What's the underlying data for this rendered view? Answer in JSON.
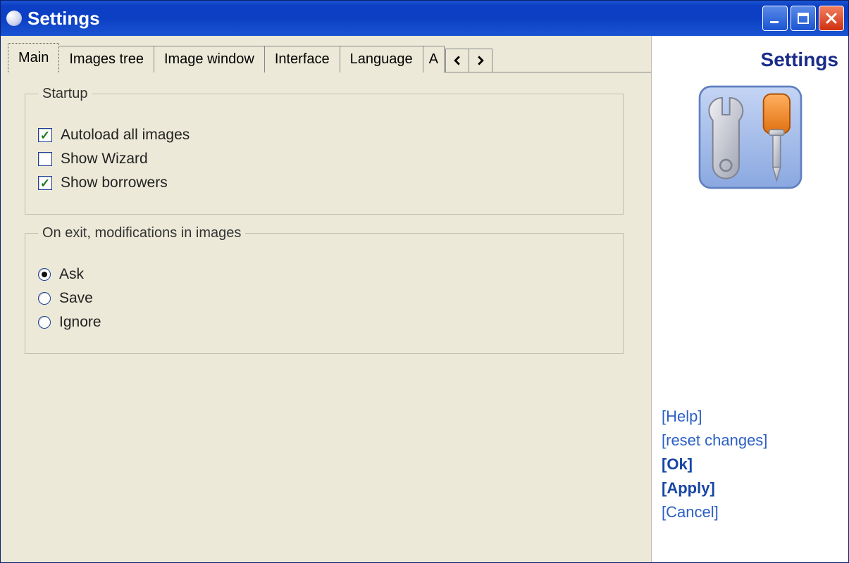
{
  "window": {
    "title": "Settings"
  },
  "tabs": {
    "items": [
      {
        "label": "Main"
      },
      {
        "label": "Images tree"
      },
      {
        "label": "Image window"
      },
      {
        "label": "Interface"
      },
      {
        "label": "Language"
      },
      {
        "label": "A"
      }
    ],
    "active_index": 0
  },
  "main": {
    "startup": {
      "legend": "Startup",
      "autoload": {
        "label": "Autoload all images",
        "checked": true
      },
      "wizard": {
        "label": "Show Wizard",
        "checked": false
      },
      "borrowers": {
        "label": "Show borrowers",
        "checked": true
      }
    },
    "exit": {
      "legend": "On exit, modifications in images",
      "selected": "ask",
      "ask": {
        "label": "Ask"
      },
      "save": {
        "label": "Save"
      },
      "ignore": {
        "label": "Ignore"
      }
    }
  },
  "side": {
    "title": "Settings",
    "links": {
      "help": "[Help]",
      "reset": "[reset changes]",
      "ok": "[Ok]",
      "apply": "[Apply]",
      "cancel": "[Cancel]"
    }
  }
}
